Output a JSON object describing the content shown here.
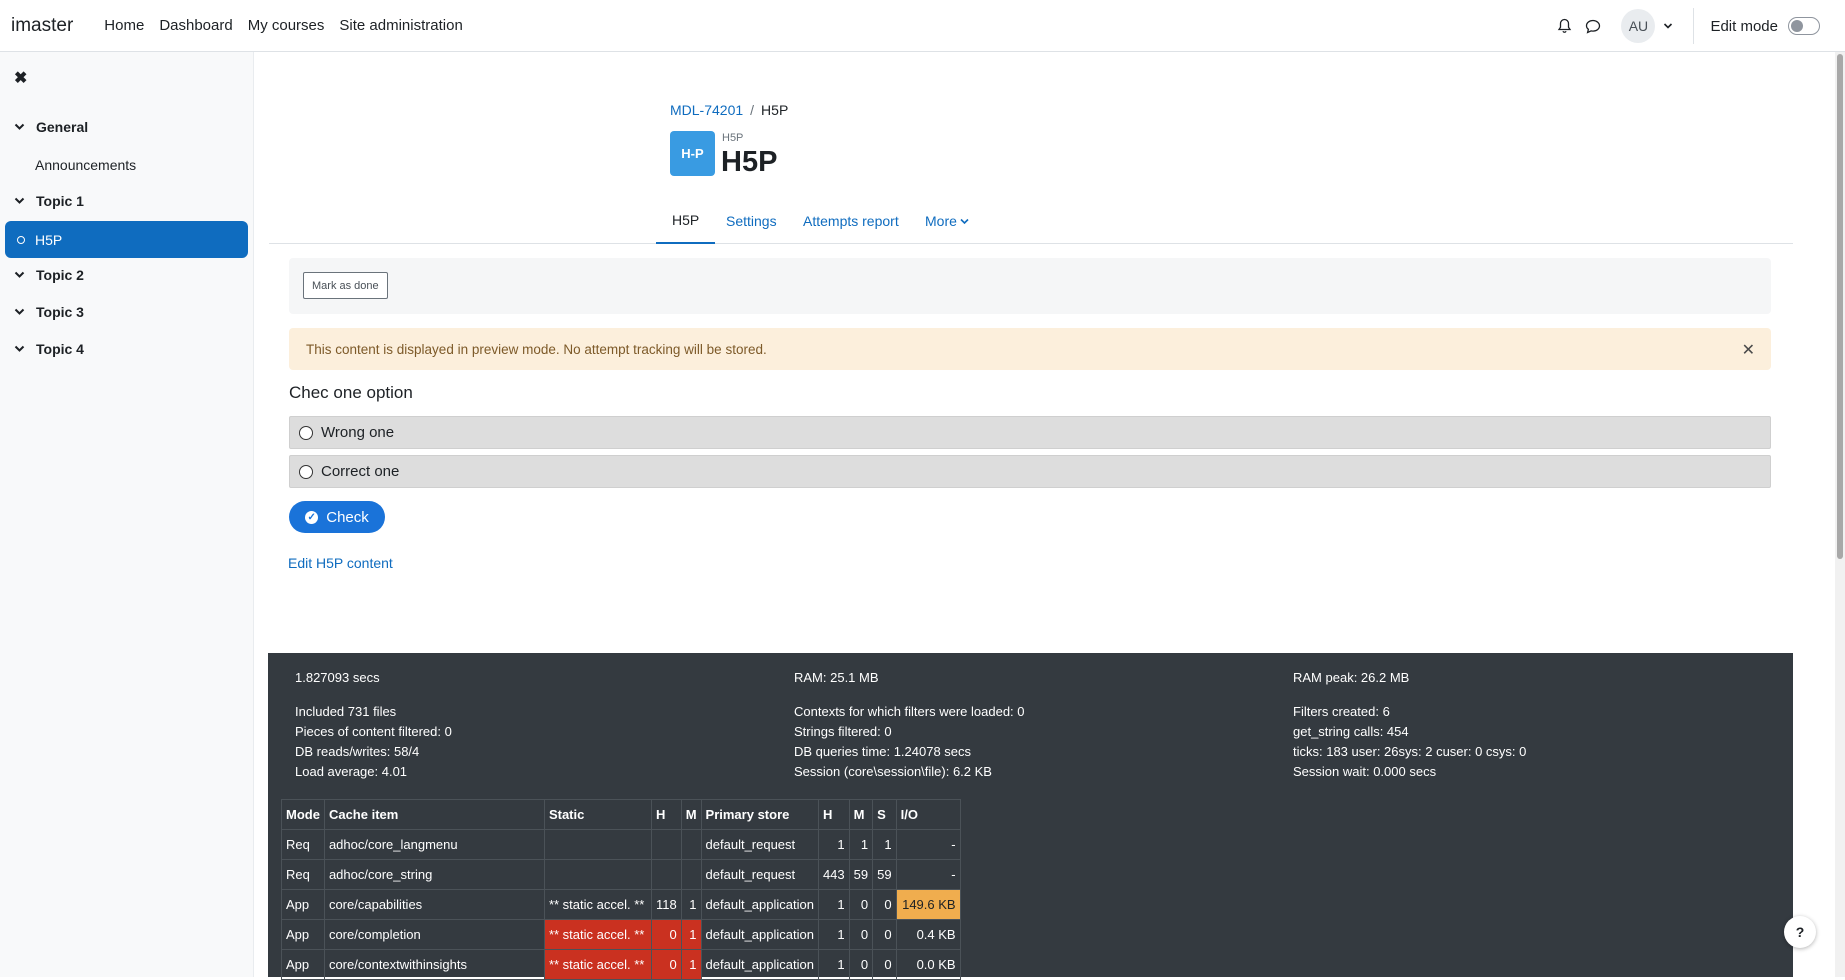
{
  "navbar": {
    "brand": "imaster",
    "links": [
      "Home",
      "Dashboard",
      "My courses",
      "Site administration"
    ],
    "avatar": "AU",
    "edit_mode_label": "Edit mode"
  },
  "sidebar": {
    "sections": [
      {
        "label": "General",
        "items": [
          "Announcements"
        ]
      },
      {
        "label": "Topic 1",
        "items": [
          "H5P"
        ]
      },
      {
        "label": "Topic 2",
        "items": []
      },
      {
        "label": "Topic 3",
        "items": []
      },
      {
        "label": "Topic 4",
        "items": []
      }
    ]
  },
  "header": {
    "breadcrumb": [
      "MDL-74201",
      "H5P"
    ],
    "activity_icon_text": "H-P",
    "activity_type": "H5P",
    "title": "H5P"
  },
  "tabs": [
    "H5P",
    "Settings",
    "Attempts report",
    "More"
  ],
  "activity": {
    "mark_done": "Mark as done",
    "alert": "This content is displayed in preview mode. No attempt tracking will be stored.",
    "question": "Chec one option",
    "options": [
      "Wrong one",
      "Correct one"
    ],
    "check_label": "Check",
    "edit_link": "Edit H5P content"
  },
  "perf": {
    "time": "1.827093 secs",
    "ram": "RAM: 25.1 MB",
    "ram_peak": "RAM peak: 26.2 MB",
    "col1": [
      "Included 731 files",
      "Pieces of content filtered: 0",
      "DB reads/writes: 58/4",
      "Load average: 4.01"
    ],
    "col2": [
      "Contexts for which filters were loaded: 0",
      "Strings filtered: 0",
      "DB queries time: 1.24078 secs",
      "Session (core\\session\\file): 6.2 KB"
    ],
    "col3": [
      "Filters created: 6",
      "get_string calls: 454",
      "ticks: 183 user: 26sys: 2 cuser: 0 csys: 0",
      "Session wait: 0.000 secs"
    ],
    "table_headers": [
      "Mode",
      "Cache item",
      "Static",
      "H",
      "M",
      "Primary store",
      "H",
      "M",
      "S",
      "I/O"
    ],
    "rows": [
      [
        "Req",
        "adhoc/core_langmenu",
        "",
        "",
        "",
        "default_request",
        "1",
        "1",
        "1",
        "-"
      ],
      [
        "Req",
        "adhoc/core_string",
        "",
        "",
        "",
        "default_request",
        "443",
        "59",
        "59",
        "-"
      ],
      [
        "App",
        "core/capabilities",
        "** static accel. **",
        "118",
        "1",
        "default_application",
        "1",
        "0",
        "0",
        "149.6 KB"
      ],
      [
        "App",
        "core/completion",
        "** static accel. **",
        "0",
        "1",
        "default_application",
        "1",
        "0",
        "0",
        "0.4 KB"
      ],
      [
        "App",
        "core/contextwithinsights",
        "** static accel. **",
        "0",
        "1",
        "default_application",
        "1",
        "0",
        "0",
        "0.0 KB"
      ]
    ]
  },
  "help_label": "?"
}
